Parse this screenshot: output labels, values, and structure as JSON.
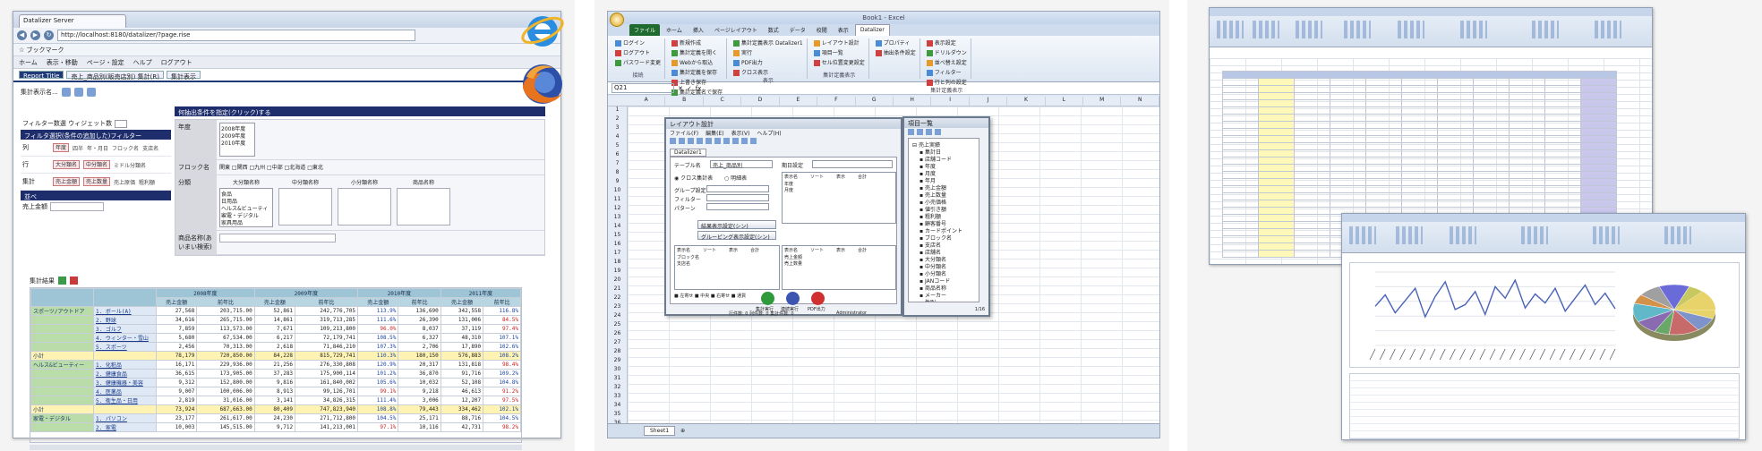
{
  "panel1": {
    "browser_tab_title": "Datalizer Server",
    "url": "http://localhost:8180/datalizer/?page.rise",
    "bookmarks_label": "☆ ブックマーク",
    "menu": [
      "ホーム",
      "表示・移動",
      "ページ・設定",
      "ヘルプ",
      "ログアウト"
    ],
    "app_tabs": [
      "Report Title",
      "売上_商品別(販売店別) 集計(R)",
      "集計表示"
    ],
    "toolbar_label": "集計表示名...",
    "filter_label": "フィルター数選 ウィジェット数",
    "left_header": "フィルタ選択(条件の追加した)フィルター",
    "axes": [
      {
        "name": "列",
        "chips": [
          "年度"
        ],
        "plain": [
          "四半",
          "年・月日",
          "フロック名",
          "支店名"
        ]
      },
      {
        "name": "行",
        "chips": [
          "大分類名",
          "中分類名",
          "小分類名"
        ],
        "plain": [
          "ミドル分類名",
          "商品名"
        ]
      },
      {
        "name": "集計",
        "chips": [
          "売上金額",
          "売上数量"
        ],
        "plain": [
          "売上原価",
          "粗利額",
          "粗利率"
        ]
      }
    ],
    "sort_header": "並べ",
    "sort_label": "売上金額",
    "right_header": "何抽出条件を指定(クリック)する",
    "filter_rows": [
      {
        "label": "年度",
        "list": [
          "2008年度",
          "2009年度",
          "2010年度"
        ]
      },
      {
        "label": "フロック名",
        "checks": "関東 □関西 □九州 □中部 □北海道 □東北"
      },
      {
        "label": "分類",
        "list": [
          "食品",
          "日用品",
          "ヘルス&ビューティー",
          "家電・デジタル",
          "家具用品"
        ],
        "columns": [
          "大分類名称",
          "中分類名称",
          "小分類名称",
          "商品名称"
        ]
      },
      {
        "label": "商品名称(あいまい検索)"
      }
    ],
    "result_label": "集計結果",
    "grid": {
      "years": [
        "2008年度",
        "2009年度",
        "2010年度",
        "2011年度"
      ],
      "subheads": [
        "売上金額",
        "前年比",
        "売上数量",
        "前年比"
      ],
      "rows": [
        {
          "type": "cat",
          "label": "スポーツ/アウトドア",
          "item": "1. ボール(A)",
          "values": [
            "27,568",
            "203,715.00",
            "52,861",
            "242,776,705",
            "113.9%",
            "136,690",
            "342,558",
            "116.8%"
          ]
        },
        {
          "type": "item",
          "label": "",
          "item": "2. 野球",
          "values": [
            "34,616",
            "265,715.00",
            "14,861",
            "319,713,285",
            "111.6%",
            "26,390",
            "131,006",
            "84.5%"
          ]
        },
        {
          "type": "item",
          "label": "",
          "item": "3. ゴルフ",
          "values": [
            "7,859",
            "113,573.00",
            "7,671",
            "109,213,800",
            "96.0%",
            "8,037",
            "37,119",
            "97.4%"
          ]
        },
        {
          "type": "item",
          "label": "",
          "item": "4. ウィンター・雪山",
          "values": [
            "5,680",
            "67,534.00",
            "6,217",
            "72,179,741",
            "108.5%",
            "6,327",
            "48,310",
            "107.1%"
          ]
        },
        {
          "type": "item",
          "label": "",
          "item": "5. スポーツ",
          "values": [
            "2,456",
            "70,313.00",
            "2,618",
            "71,846,210",
            "107.3%",
            "2,706",
            "17,890",
            "102.6%"
          ]
        },
        {
          "type": "subtotal",
          "label": "小計",
          "item": "",
          "values": [
            "78,179",
            "720,850.00",
            "84,228",
            "815,729,741",
            "110.3%",
            "180,150",
            "576,883",
            "108.2%"
          ]
        },
        {
          "type": "cat",
          "label": "ヘルス&ビューティー",
          "item": "1. 化粧品",
          "values": [
            "16,171",
            "229,936.00",
            "21,256",
            "276,330,808",
            "120.9%",
            "20,317",
            "131,818",
            "98.4%"
          ]
        },
        {
          "type": "item",
          "label": "",
          "item": "2. 健康食品",
          "values": [
            "36,615",
            "173,905.00",
            "37,283",
            "175,900,114",
            "101.2%",
            "36,870",
            "91,716",
            "109.2%"
          ]
        },
        {
          "type": "item",
          "label": "",
          "item": "3. 健康機器・美容",
          "values": [
            "9,312",
            "152,800.00",
            "9,816",
            "161,840,002",
            "105.6%",
            "10,032",
            "52,108",
            "104.8%"
          ]
        },
        {
          "type": "item",
          "label": "",
          "item": "4. 医薬品",
          "values": [
            "9,007",
            "100,006.00",
            "8,913",
            "99,126,701",
            "99.1%",
            "9,218",
            "46,613",
            "91.2%"
          ]
        },
        {
          "type": "item",
          "label": "",
          "item": "5. 衛生品・日用",
          "values": [
            "2,819",
            "31,016.00",
            "3,141",
            "34,826,315",
            "111.4%",
            "3,006",
            "12,207",
            "97.5%"
          ]
        },
        {
          "type": "subtotal",
          "label": "小計",
          "item": "",
          "values": [
            "73,924",
            "687,663.00",
            "80,409",
            "747,823,940",
            "108.8%",
            "79,443",
            "334,462",
            "102.1%"
          ]
        },
        {
          "type": "cat",
          "label": "家電・デジタル",
          "item": "1. パソコン",
          "values": [
            "23,177",
            "261,617.00",
            "24,230",
            "271,712,800",
            "104.5%",
            "25,171",
            "88,716",
            "104.5%"
          ]
        },
        {
          "type": "item",
          "label": "",
          "item": "2. 家電",
          "values": [
            "10,003",
            "145,515.00",
            "9,712",
            "141,213,001",
            "97.1%",
            "10,116",
            "42,731",
            "98.2%"
          ]
        }
      ]
    }
  },
  "panel2": {
    "window_title": "Book1 - Excel",
    "ribbon_tabs": [
      "ファイル",
      "ホーム",
      "挿入",
      "ページレイアウト",
      "数式",
      "データ",
      "校閲",
      "表示",
      "Datalizer"
    ],
    "ribbon_groups": [
      {
        "name": "接続",
        "items": [
          "ログイン",
          "ログアウト",
          "パスワード変更"
        ]
      },
      {
        "name": "ファイル",
        "items": [
          "新規作成",
          "集計定義を開く",
          "Webから取込",
          "集計定義を保存",
          "上書き保存",
          "集計定義名で保存"
        ]
      },
      {
        "name": "表示",
        "items": [
          "集計定義表示 Datalizer1",
          "実行",
          "PDF出力",
          "クロス表示"
        ]
      },
      {
        "name": "集計定義表示",
        "items": [
          "レイアウト設計",
          "項目一覧",
          "セル位置変更設定"
        ]
      },
      {
        "name": "",
        "items": [
          "プロパティ",
          "抽出条件設定"
        ]
      },
      {
        "name": "集計定義表示",
        "items": [
          "表示設定",
          "ドリルダウン",
          "並べ替え設定",
          "フィルター",
          "行と列の設定"
        ]
      }
    ],
    "namebox": "Q21",
    "columns": [
      "A",
      "B",
      "C",
      "D",
      "E",
      "F",
      "G",
      "H",
      "I",
      "J",
      "K",
      "L",
      "M",
      "N"
    ],
    "sheet_tab": "Sheet1",
    "layout_dialog": {
      "title": "レイアウト設計",
      "menu": [
        "ファイル(F)",
        "編集(E)",
        "表示(V)",
        "ヘルプ(H)"
      ],
      "tab": "Datalizer1",
      "table_label": "テーブル名",
      "table_value": "売上_商品別",
      "period_label": "期日設定",
      "radio_cross": "クロス集計表",
      "radio_list": "明細表",
      "row_labels": [
        "グループ設定",
        "フィルター",
        "パターン"
      ],
      "list_headers": [
        "表示名",
        "ソート",
        "表示",
        "合計"
      ],
      "col_items": [
        "年度",
        "月度"
      ],
      "row_items": [
        "ブロック名",
        "支店名"
      ],
      "sum_items": [
        "売上金額",
        "売上数量"
      ],
      "btn_result": "結果表示設定(シン)",
      "btn_group": "グルーピング表示設定(シン)",
      "legend": [
        "左寄せ",
        "中央",
        "右寄せ",
        "通貨"
      ],
      "run_labels": [
        "集計実行",
        "連続実行",
        "PDF出力"
      ],
      "status": "行件数: 0 列件数: 0 集計件数: 0",
      "user": "Administrator"
    },
    "items_dialog": {
      "title": "項目一覧",
      "tree": [
        "売上実績",
        "集計日",
        "店舗コード",
        "年度",
        "月度",
        "年月",
        "売上金額",
        "売上数量",
        "小売価格",
        "値引き額",
        "粗利額",
        "顧客番号",
        "カードポイント",
        "ブロック名",
        "支店名",
        "店舗名",
        "大分類名",
        "中分類名",
        "小分類名",
        "JANコード",
        "商品名称",
        "メーカー",
        "性別",
        "年代",
        "住所",
        "地域",
        "職業番号",
        "都道府県"
      ],
      "status": "1/16"
    }
  },
  "panel3": {
    "chart_series_points": [
      48,
      62,
      40,
      55,
      70,
      35,
      60,
      78,
      44,
      50,
      66,
      38,
      72,
      58,
      80,
      46,
      63,
      52,
      70,
      42,
      58,
      74,
      50,
      64,
      45
    ],
    "pie_colors": [
      "#e8d36a",
      "#7d93c9",
      "#c86a6a",
      "#6aa86a",
      "#8a6ab0",
      "#60b8c8",
      "#d4914a",
      "#a0a0a0",
      "#6a6ad8",
      "#c8c860"
    ]
  }
}
